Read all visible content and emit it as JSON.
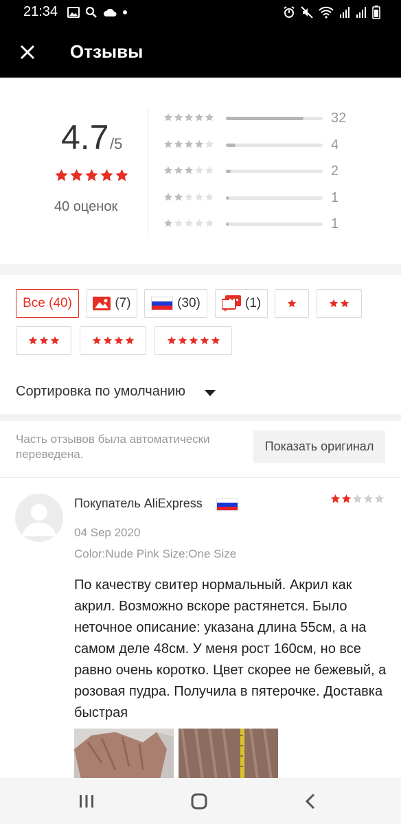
{
  "status_bar": {
    "time": "21:34",
    "icons_left": [
      "image-icon",
      "search-icon",
      "cloud-icon",
      "dot-icon"
    ],
    "icons_right": [
      "alarm-icon",
      "mute-icon",
      "wifi-icon",
      "signal-icon",
      "signal-icon",
      "battery-icon"
    ]
  },
  "header": {
    "title": "Отзывы",
    "close_icon": "close-icon"
  },
  "summary": {
    "average": "4.7",
    "max": "/5",
    "avg_stars": 5,
    "count_label": "40 оценок",
    "distribution": [
      {
        "stars": 5,
        "count": "32",
        "fraction": 0.8
      },
      {
        "stars": 4,
        "count": "4",
        "fraction": 0.1
      },
      {
        "stars": 3,
        "count": "2",
        "fraction": 0.05
      },
      {
        "stars": 2,
        "count": "1",
        "fraction": 0.025
      },
      {
        "stars": 1,
        "count": "1",
        "fraction": 0.025
      }
    ]
  },
  "filters": {
    "all": "Все (40)",
    "photo_count": "(7)",
    "russia_count": "(30)",
    "translated_count": "(1)",
    "star_filters": [
      1,
      2,
      3,
      4,
      5
    ]
  },
  "sort": {
    "label": "Сортировка по умолчанию"
  },
  "notice": {
    "text": "Часть отзывов была автоматически переведена.",
    "button": "Показать оригинал"
  },
  "review": {
    "name": "Покупатель AliExpress",
    "stars": 2,
    "date": "04 Sep 2020",
    "sku": "Color:Nude Pink Size:One Size",
    "text": "По качеству свитер нормальный. Акрил как акрил. Возможно вскоре растянется. Было неточное описание: указана длина 55см, а на самом деле 48см. У меня рост 160см, но все равно очень коротко. Цвет скорее не бежевый, а розовая пудра. Получила в пятерочке. Доставка быстрая"
  },
  "colors": {
    "accent": "#e62e24",
    "star_gray": "#cfcfcf",
    "header_bg": "#000000"
  },
  "nav": {
    "icons": [
      "recent-apps-icon",
      "home-icon",
      "back-icon"
    ]
  }
}
